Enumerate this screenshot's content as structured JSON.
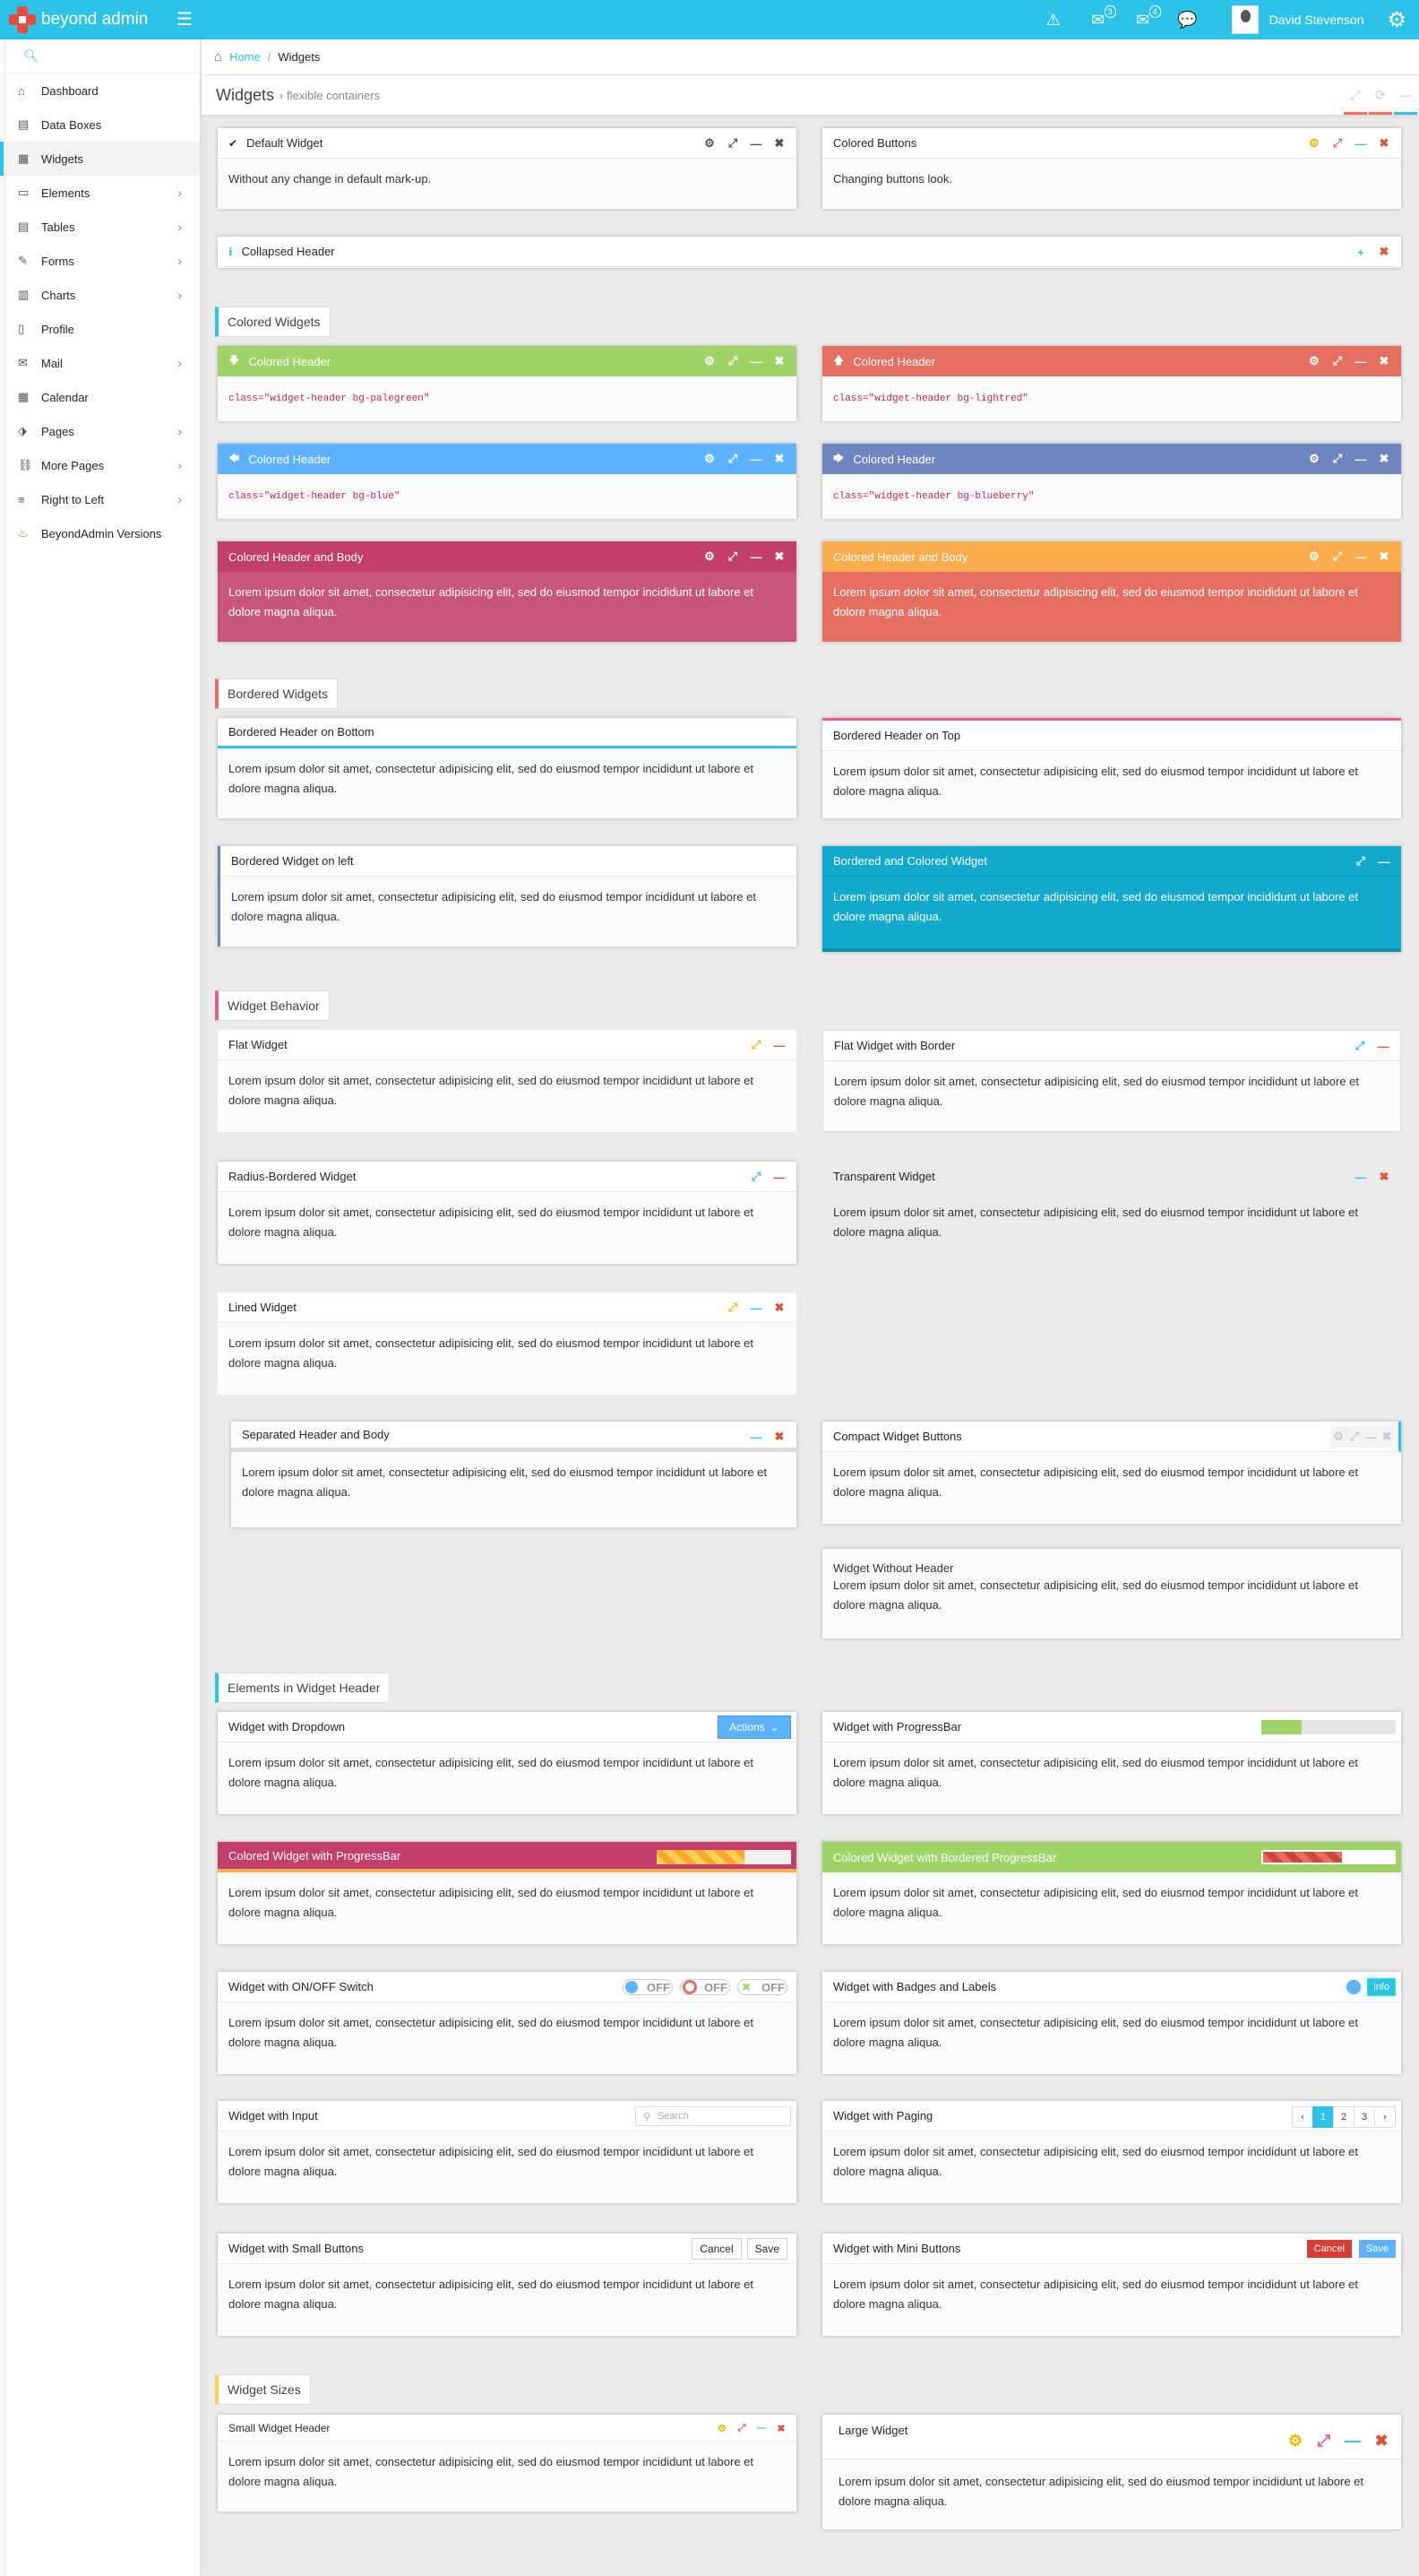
{
  "app": {
    "name": "beyond admin",
    "user": "David Stevenson",
    "mail_count": "3",
    "chat_count": "4"
  },
  "sidebar": {
    "items": [
      {
        "label": "Dashboard",
        "icon": "home-icon",
        "arrow": false
      },
      {
        "label": "Data Boxes",
        "icon": "boxes-icon",
        "arrow": false
      },
      {
        "label": "Widgets",
        "icon": "grid-icon",
        "arrow": false,
        "active": true
      },
      {
        "label": "Elements",
        "icon": "monitor-icon",
        "arrow": true
      },
      {
        "label": "Tables",
        "icon": "table-icon",
        "arrow": true
      },
      {
        "label": "Forms",
        "icon": "edit-icon",
        "arrow": true
      },
      {
        "label": "Charts",
        "icon": "chart-icon",
        "arrow": true
      },
      {
        "label": "Profile",
        "icon": "document-icon",
        "arrow": false
      },
      {
        "label": "Mail",
        "icon": "mail-icon",
        "arrow": true
      },
      {
        "label": "Calendar",
        "icon": "calendar-icon",
        "arrow": false
      },
      {
        "label": "Pages",
        "icon": "tag-icon",
        "arrow": true
      },
      {
        "label": "More Pages",
        "icon": "link-icon",
        "arrow": true
      },
      {
        "label": "Right to Left",
        "icon": "align-right-icon",
        "arrow": true
      },
      {
        "label": "BeyondAdmin Versions",
        "icon": "fire-icon",
        "arrow": false
      }
    ]
  },
  "breadcrumb": {
    "home": "Home",
    "current": "Widgets"
  },
  "header": {
    "title": "Widgets",
    "subtitle": "flexible containers"
  },
  "sections": {
    "colored": "Colored Widgets",
    "bordered": "Bordered Widgets",
    "behavior": "Widget Behavior",
    "elements": "Elements in Widget Header",
    "sizes": "Widget Sizes"
  },
  "lorem": "Lorem ipsum dolor sit amet, consectetur adipisicing elit, sed do eiusmod tempor incididunt ut labore et dolore magna aliqua.",
  "w": {
    "default_title": "Default Widget",
    "default_body": "Without any change in default mark-up.",
    "colored_buttons_title": "Colored Buttons",
    "colored_buttons_body": "Changing buttons look.",
    "collapsed_title": "Collapsed Header",
    "colored_header": "Colored Header",
    "code_palegreen": "class=\"widget-header bg-palegreen\"",
    "code_lightred": "class=\"widget-header bg-lightred\"",
    "code_blue": "class=\"widget-header bg-blue\"",
    "code_blueberry": "class=\"widget-header bg-blueberry\"",
    "colored_header_body": "Colored Header and Body",
    "bordered_bottom": "Bordered Header on Bottom",
    "bordered_top": "Bordered Header on Top",
    "bordered_left": "Bordered Widget on left",
    "bordered_colored": "Bordered and Colored Widget",
    "flat": "Flat Widget",
    "flat_border": "Flat Widget with Border",
    "radius": "Radius-Bordered Widget",
    "transparent": "Transparent Widget",
    "lined": "Lined Widget",
    "separated": "Separated Header and Body",
    "compact": "Compact Widget Buttons",
    "no_header": "Widget Without Header",
    "dropdown": "Widget with Dropdown",
    "actions": "Actions",
    "progressbar": "Widget with ProgressBar",
    "colored_progress": "Colored Widget with ProgressBar",
    "colored_bordered_progress": "Colored Widget with Bordered ProgressBar",
    "onoff": "Widget with ON/OFF Switch",
    "off": "OFF",
    "badges": "Widget with Badges and Labels",
    "info": "info",
    "input": "Widget with Input",
    "search_placeholder": "Search",
    "paging": "Widget with Paging",
    "pages": [
      "‹",
      "1",
      "2",
      "3",
      "›"
    ],
    "small_buttons": "Widget with Small Buttons",
    "cancel": "Cancel",
    "save": "Save",
    "mini_buttons": "Widget with Mini Buttons",
    "small_header": "Small Widget Header",
    "large": "Large Widget"
  },
  "progress": {
    "p1": 0.3,
    "p2": 0.65,
    "p3": 0.6
  },
  "colors": {
    "accent": "#2dc3e8",
    "palegreen": "#a0d468",
    "lightred": "#e46f61",
    "blue": "#5db2ff",
    "blueberry": "#6f85bf",
    "maroon": "#c13e6d",
    "orange": "#fb6e52",
    "yellow": "#ffce55",
    "darkblue": "#11a9cc"
  }
}
